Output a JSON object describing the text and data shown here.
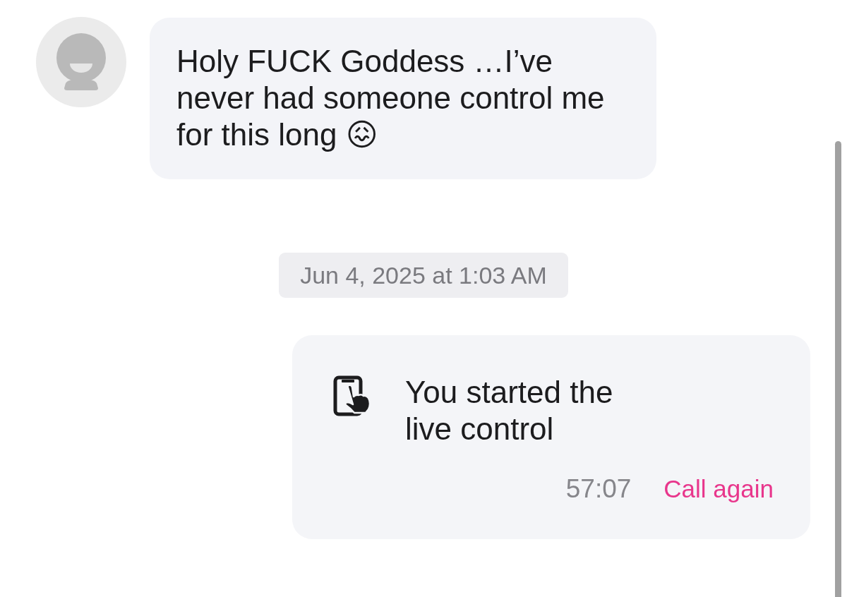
{
  "messages": [
    {
      "kind": "text",
      "outgoing": false,
      "text": "Holy FUCK Goddess …I’ve never had someone control me for this long 😖"
    },
    {
      "kind": "timestamp",
      "text": "Jun 4, 2025 at 1:03 AM"
    },
    {
      "kind": "call",
      "outgoing": true,
      "text": "You started the live control",
      "duration": "57:07",
      "action": "Call again"
    }
  ]
}
